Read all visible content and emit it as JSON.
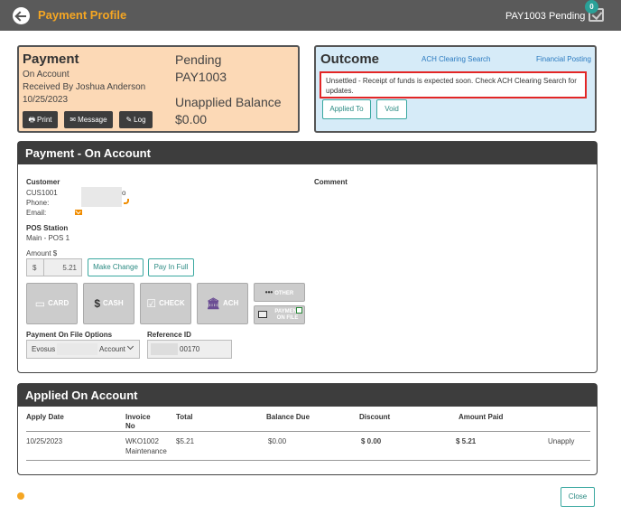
{
  "header": {
    "title": "Payment Profile",
    "payment_id": "PAY1003",
    "status": "Pending",
    "badge_count": "0"
  },
  "payment_card": {
    "title": "Payment",
    "type": "On Account",
    "received_by": "Received By Joshua Anderson",
    "date": "10/25/2023",
    "status": "Pending",
    "id": "PAY1003",
    "unapplied_label": "Unapplied Balance",
    "unapplied_value": "$0.00",
    "buttons": {
      "print": "Print",
      "message": "Message",
      "log": "Log"
    }
  },
  "outcome": {
    "title": "Outcome",
    "link_ach": "ACH Clearing Search",
    "link_financial": "Financial Posting",
    "message": "Unsettled - Receipt of funds is expected soon. Check ACH Clearing Search for updates.",
    "btn_applied": "Applied To",
    "btn_void": "Void"
  },
  "payment_section": {
    "title": "Payment - On Account",
    "customer_label": "Customer",
    "customer_id": "CUS1001",
    "customer_name_suffix": "o",
    "phone_label": "Phone:",
    "email_label": "Email:",
    "comment_label": "Comment",
    "pos_label": "POS Station",
    "pos_value": "Main - POS 1",
    "amount_label": "Amount $",
    "currency_symbol": "$",
    "amount_value": "5.21",
    "btn_make_change": "Make Change",
    "btn_pay_full": "Pay In Full",
    "tenders": {
      "card": "CARD",
      "cash": "CASH",
      "check": "CHECK",
      "ach": "ACH",
      "other": "OTHER",
      "payment_on_file": "PAYMENT ON FILE"
    },
    "pof_label": "Payment On File Options",
    "pof_value_prefix": "Evosus",
    "pof_value_suffix": "Account",
    "ref_label": "Reference ID",
    "ref_value": "00170"
  },
  "applied_section": {
    "title": "Applied On Account",
    "columns": {
      "apply_date": "Apply Date",
      "invoice_no": "Invoice No",
      "total": "Total",
      "balance_due": "Balance Due",
      "discount": "Discount",
      "amount_paid": "Amount Paid"
    },
    "rows": [
      {
        "apply_date": "10/25/2023",
        "invoice": "WKO1002",
        "invoice_type": "Maintenance",
        "total": "$5.21",
        "balance_due": "$0.00",
        "discount": "$ 0.00",
        "amount_paid": "$ 5.21",
        "action": "Unapply"
      }
    ]
  },
  "footer": {
    "close": "Close"
  }
}
